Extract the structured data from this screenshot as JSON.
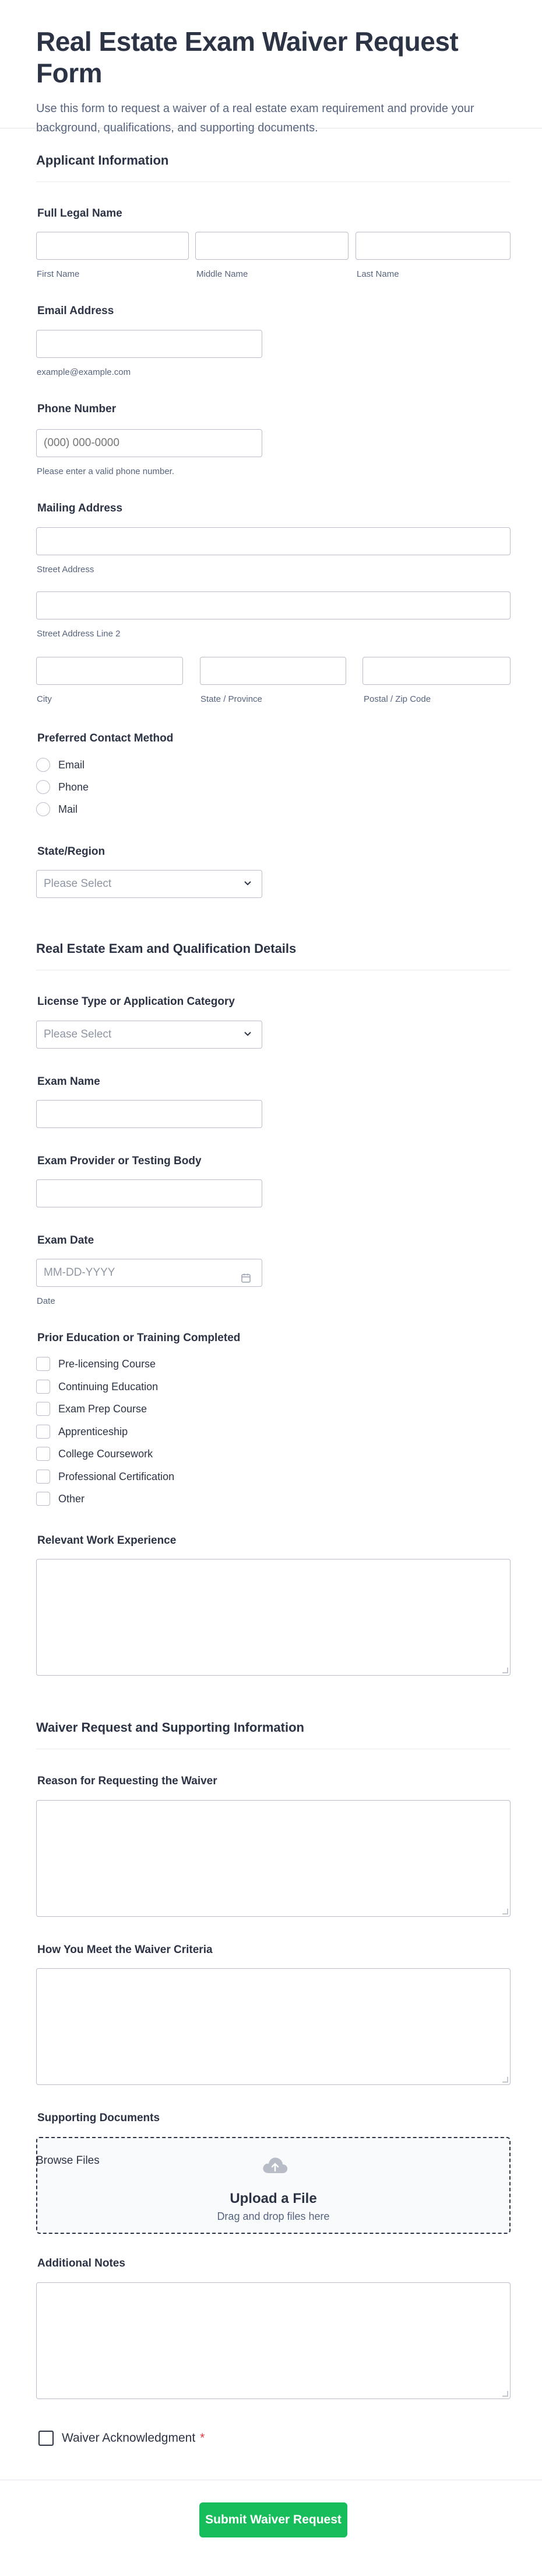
{
  "header": {
    "title": "Real Estate Exam Waiver Request Form",
    "description": "Use this form to request a waiver of a real estate exam requirement and provide your background, qualifications, and supporting documents."
  },
  "sections": {
    "applicant": "Applicant Information",
    "exam": "Real Estate Exam and Qualification Details",
    "waiver": "Waiver Request and Supporting Information"
  },
  "full_name": {
    "label": "Full Legal Name",
    "first": "First Name",
    "middle": "Middle Name",
    "last": "Last Name"
  },
  "email": {
    "label": "Email Address",
    "hint": "example@example.com"
  },
  "phone": {
    "label": "Phone Number",
    "placeholder": "(000) 000-0000",
    "hint": "Please enter a valid phone number."
  },
  "address": {
    "label": "Mailing Address",
    "street": "Street Address",
    "street2": "Street Address Line 2",
    "city": "City",
    "state": "State / Province",
    "zip": "Postal / Zip Code"
  },
  "contact_method": {
    "label": "Preferred Contact Method",
    "options": [
      "Email",
      "Phone",
      "Mail"
    ]
  },
  "state_region": {
    "label": "State/Region",
    "placeholder": "Please Select"
  },
  "license_type": {
    "label": "License Type or Application Category",
    "placeholder": "Please Select"
  },
  "exam_name": {
    "label": "Exam Name"
  },
  "exam_provider": {
    "label": "Exam Provider or Testing Body"
  },
  "exam_date": {
    "label": "Exam Date",
    "placeholder": "MM-DD-YYYY",
    "hint": "Date"
  },
  "prior_education": {
    "label": "Prior Education or Training Completed",
    "options": [
      "Pre-licensing Course",
      "Continuing Education",
      "Exam Prep Course",
      "Apprenticeship",
      "College Coursework",
      "Professional Certification",
      "Other"
    ]
  },
  "work_experience": {
    "label": "Relevant Work Experience"
  },
  "reason": {
    "label": "Reason for Requesting the Waiver"
  },
  "criteria": {
    "label": "How You Meet the Waiver Criteria"
  },
  "documents": {
    "label": "Supporting Documents",
    "browse": "Browse Files",
    "title": "Upload a File",
    "hint": "Drag and drop files here"
  },
  "notes": {
    "label": "Additional Notes"
  },
  "acknowledgment": {
    "label": "Waiver Acknowledgment",
    "required_mark": "*"
  },
  "submit": {
    "label": "Submit Waiver Request"
  },
  "colors": {
    "text": "#2c3345",
    "muted": "#57647e",
    "border": "#b8bdc9",
    "submit": "#18bd5b",
    "required": "#e23a3a"
  }
}
